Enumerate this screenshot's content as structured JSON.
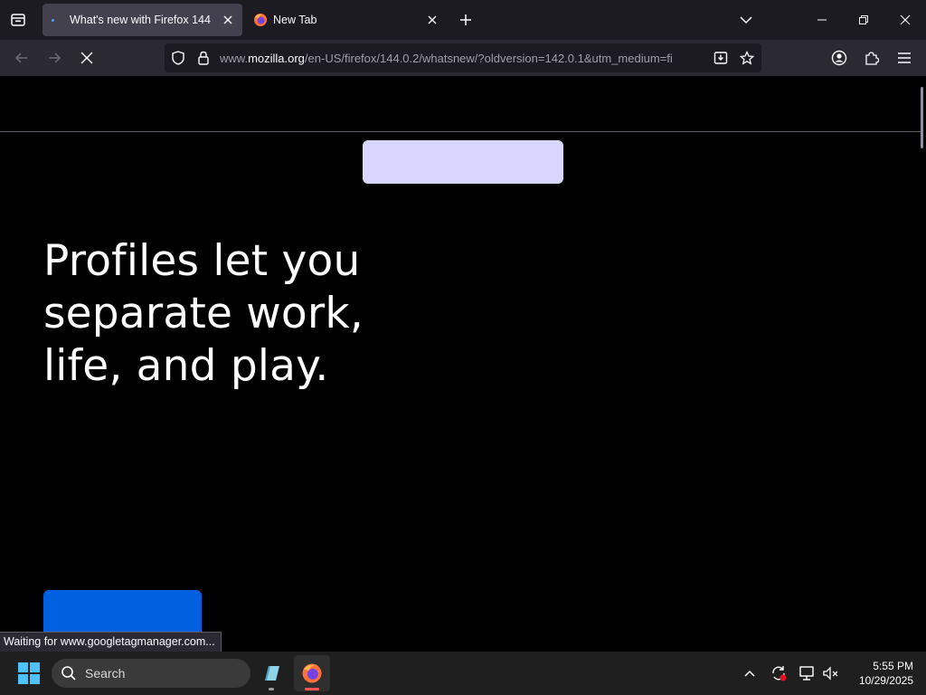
{
  "browser": {
    "tabs": [
      {
        "label": "What's new with Firefox 144",
        "state": "loading",
        "active": true
      },
      {
        "label": "New Tab",
        "active": false
      }
    ],
    "url": {
      "prefix": "www.",
      "domain": "mozilla.org",
      "path": "/en-US/firefox/144.0.2/whatsnew/?oldversion=142.0.1&utm_medium=fi"
    },
    "status_text": "Waiting for www.googletagmanager.com..."
  },
  "page": {
    "headline": "Profiles let you separate work, life, and play."
  },
  "taskbar": {
    "search_label": "Search",
    "time": "5:55 PM",
    "date": "10/29/2025"
  },
  "colors": {
    "lavender_button": "#d9d6fd",
    "blue_button": "#0060df",
    "tab_active_bg": "#42414d",
    "toolbar_bg": "#2b2a33"
  }
}
